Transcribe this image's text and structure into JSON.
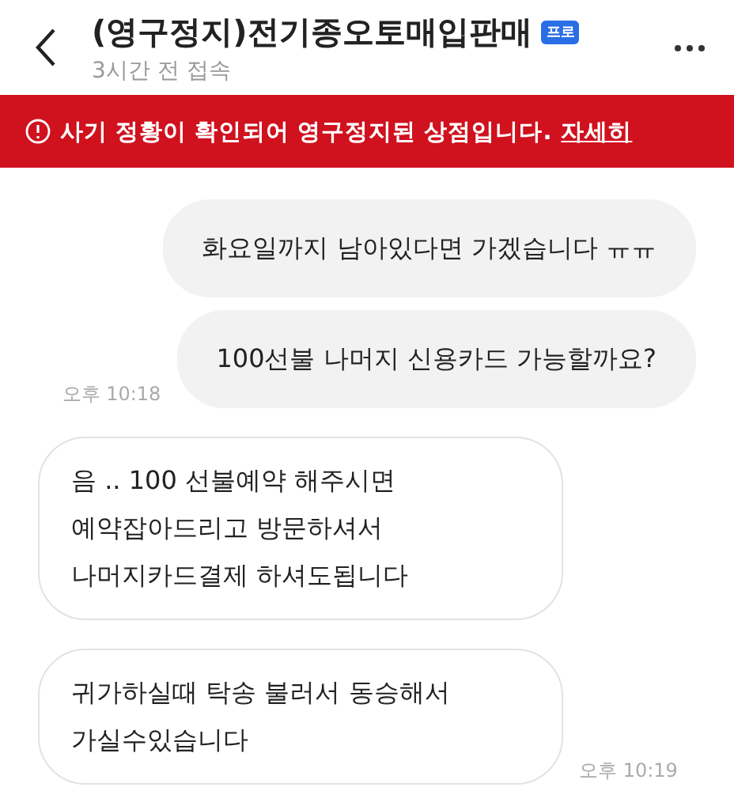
{
  "header": {
    "title": "(영구정지)전기종오토매입판매",
    "badge": "프로",
    "status": "3시간 전 접속"
  },
  "banner": {
    "text": "사기 정황이 확인되어 영구정지된 상점입니다.",
    "link": "자세히"
  },
  "messages": [
    {
      "kind": "outgoing",
      "text": "화요일까지 남아있다면 가겠습니다 ㅠㅠ"
    },
    {
      "kind": "outgoing",
      "text": "100선불 나머지 신용카드 가능할까요?",
      "time": "오후 10:18"
    },
    {
      "kind": "incoming",
      "text": "음 .. 100 선불예약 해주시면\n예약잡아드리고 방문하셔서\n나머지카드결제 하셔도됩니다"
    },
    {
      "kind": "incoming",
      "text": "귀가하실때 탁송 불러서 동승해서\n가실수있습니다",
      "time": "오후 10:19"
    }
  ]
}
